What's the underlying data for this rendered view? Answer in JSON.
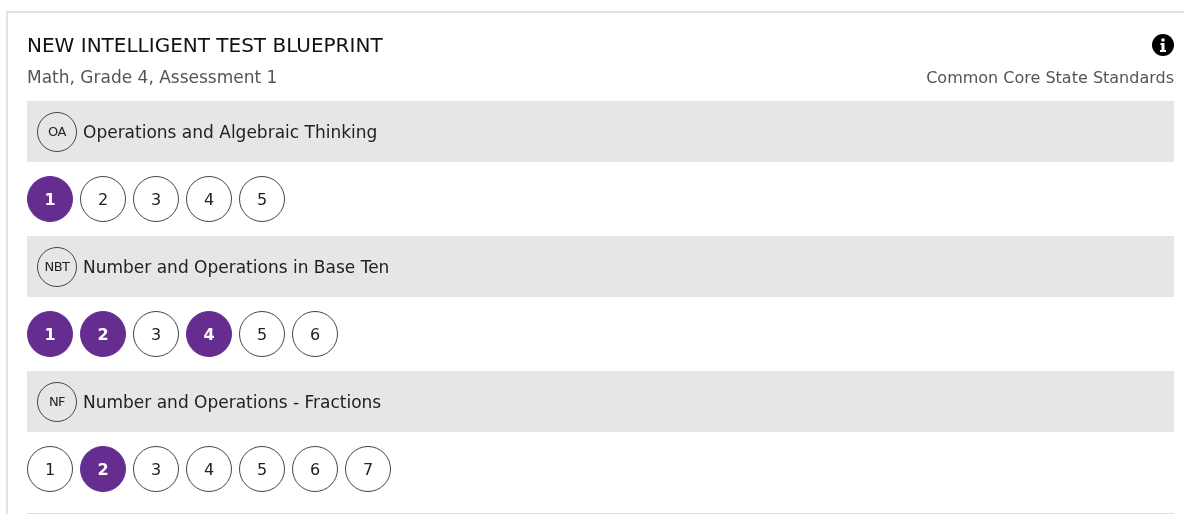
{
  "header": {
    "title": "NEW INTELLIGENT TEST BLUEPRINT",
    "subtitle": "Math, Grade 4, Assessment 1",
    "standards": "Common Core State Standards"
  },
  "domains": [
    {
      "code": "OA",
      "name": "Operations and Algebraic Thinking",
      "standards": [
        {
          "label": "1",
          "selected": true
        },
        {
          "label": "2",
          "selected": false
        },
        {
          "label": "3",
          "selected": false
        },
        {
          "label": "4",
          "selected": false
        },
        {
          "label": "5",
          "selected": false
        }
      ]
    },
    {
      "code": "NBT",
      "name": "Number and Operations in Base Ten",
      "standards": [
        {
          "label": "1",
          "selected": true
        },
        {
          "label": "2",
          "selected": true
        },
        {
          "label": "3",
          "selected": false
        },
        {
          "label": "4",
          "selected": true
        },
        {
          "label": "5",
          "selected": false
        },
        {
          "label": "6",
          "selected": false
        }
      ]
    },
    {
      "code": "NF",
      "name": "Number and Operations - Fractions",
      "standards": [
        {
          "label": "1",
          "selected": false
        },
        {
          "label": "2",
          "selected": true
        },
        {
          "label": "3",
          "selected": false
        },
        {
          "label": "4",
          "selected": false
        },
        {
          "label": "5",
          "selected": false
        },
        {
          "label": "6",
          "selected": false
        },
        {
          "label": "7",
          "selected": false
        }
      ]
    }
  ]
}
